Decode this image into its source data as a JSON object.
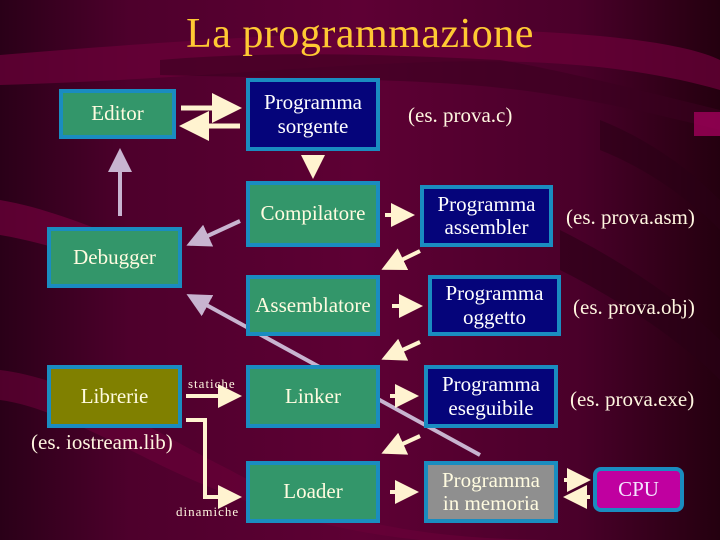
{
  "title": "La programmazione",
  "boxes": {
    "editor": "Editor",
    "sorgente_1": "Programma",
    "sorgente_2": "sorgente",
    "compilatore": "Compilatore",
    "debugger": "Debugger",
    "assemblatore": "Assemblatore",
    "assembler_1": "Programma",
    "assembler_2": "assembler",
    "oggetto_1": "Programma",
    "oggetto_2": "oggetto",
    "librerie": "Librerie",
    "linker": "Linker",
    "eseguibile_1": "Programma",
    "eseguibile_2": "eseguibile",
    "loader": "Loader",
    "memoria_1": "Programma",
    "memoria_2": "in memoria",
    "cpu": "CPU"
  },
  "notes": {
    "sorgente": "(es. prova.c)",
    "assembler": "(es. prova.asm)",
    "oggetto": "(es. prova.obj)",
    "eseguibile": "(es. prova.exe)",
    "librerie": "(es. iostream.lib)"
  },
  "labels": {
    "statiche": "statiche",
    "dinamiche": "dinamiche"
  },
  "colors": {
    "title": "#ffc933",
    "tool_box": "#33966a",
    "program_box": "#05047a",
    "library_box": "#808000",
    "memory_box": "#8f8f8f",
    "cpu_box": "#c000a0",
    "box_border": "#1a8cc0",
    "flow_arrow": "#fff3d0",
    "debug_arrow": "#c8b4d0"
  }
}
